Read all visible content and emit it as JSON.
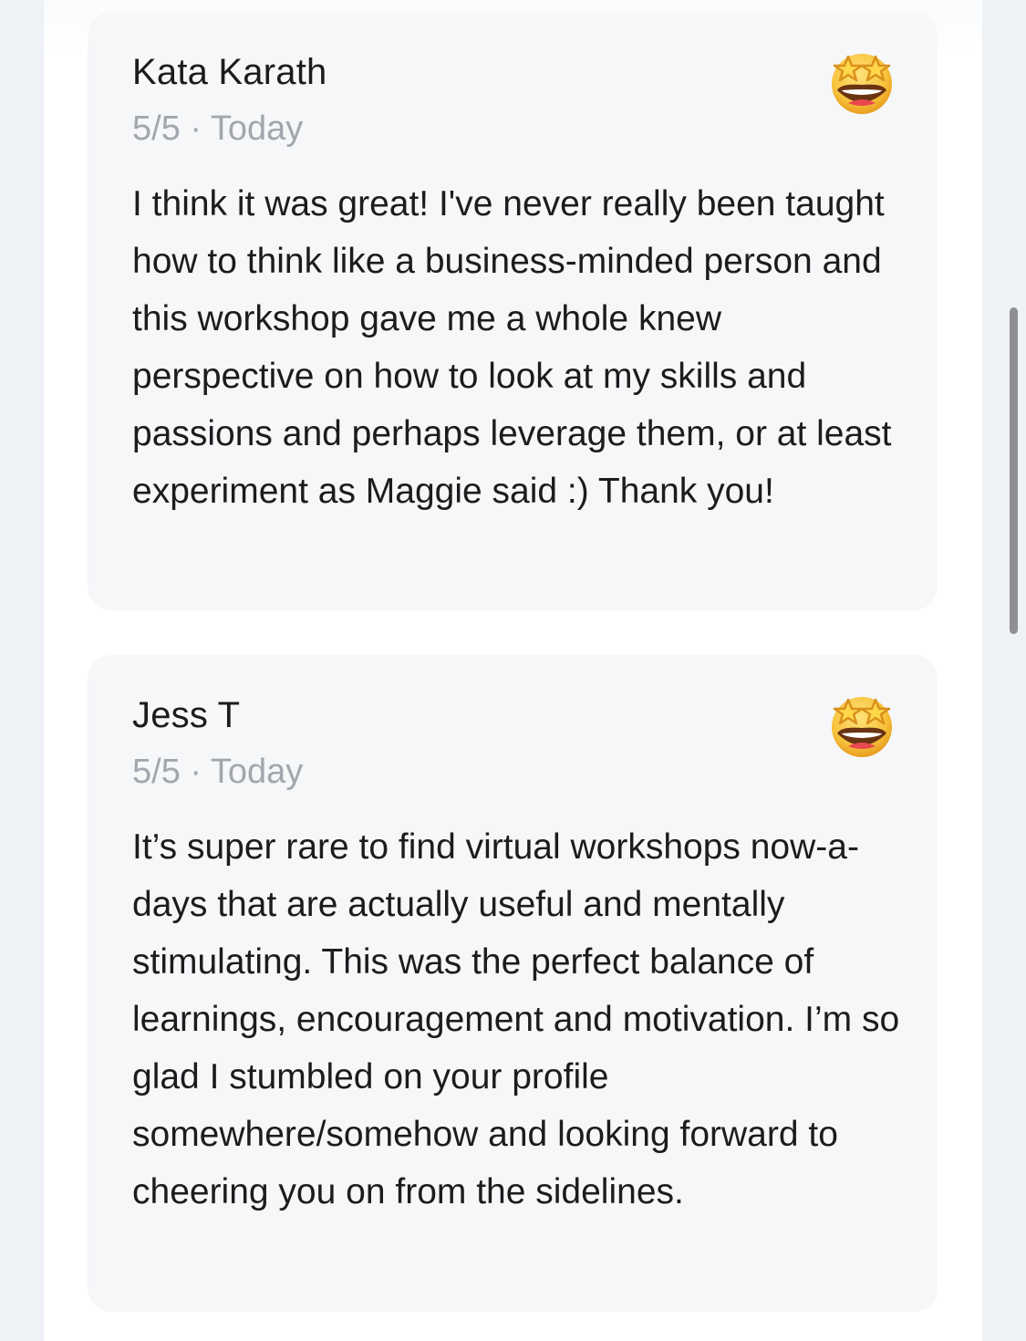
{
  "reviews": [
    {
      "name": "Kata Karath",
      "meta": "5/5 · Today",
      "reaction_icon": "star-struck-emoji-icon",
      "body": "I think it was great! I've never really been taught how to think like a business-minded person and this workshop gave me a whole knew perspective on how to look at my skills and passions and perhaps leverage them, or at least experiment as Maggie said :) Thank you!"
    },
    {
      "name": "Jess T",
      "meta": "5/5 · Today",
      "reaction_icon": "star-struck-emoji-icon",
      "body": "It’s super rare to find virtual workshops now-a-days that are actually useful and mentally stimulating. This was the perfect balance of learnings, encouragement and motivation. I’m so glad I stumbled on your profile somewhere/somehow and looking forward to cheering you on from the sidelines."
    }
  ]
}
